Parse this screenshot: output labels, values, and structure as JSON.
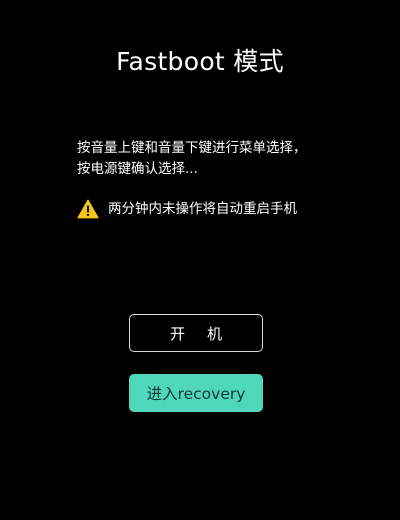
{
  "screen": {
    "title": "Fastboot 模式",
    "instructions": [
      "按音量上键和音量下键进行菜单选择，",
      "按电源键确认选择..."
    ],
    "warning": {
      "icon": "warning-triangle-icon",
      "text": "两分钟内未操作将自动重启手机",
      "icon_color": "#f5c518"
    },
    "buttons": {
      "boot_label_chars": [
        "开",
        "机"
      ],
      "recovery_label": "进入recovery"
    },
    "colors": {
      "background": "#000000",
      "accent": "#4ed7bb"
    }
  }
}
